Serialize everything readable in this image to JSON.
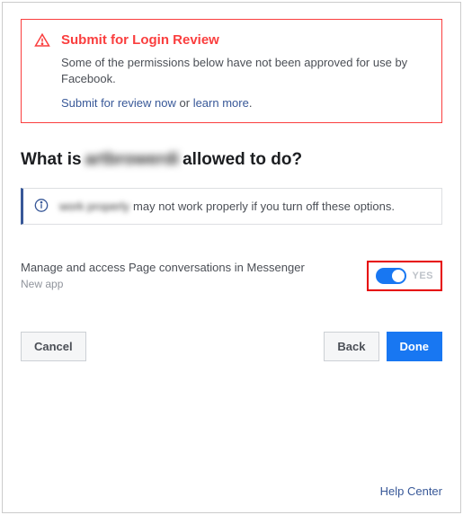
{
  "alert": {
    "title": "Submit for Login Review",
    "description": "Some of the permissions below have not been approved for use by Facebook.",
    "submit_link": "Submit for review now",
    "or_text": " or ",
    "learn_link": "learn more",
    "period": "."
  },
  "heading": {
    "prefix": "What is ",
    "blurred": "artbrowerdi",
    "suffix": "allowed to do?"
  },
  "info": {
    "blurred": "work properly",
    "text": "may not work properly if you turn off these options."
  },
  "permission": {
    "label": "Manage and access Page conversations in Messenger",
    "sublabel": "New app",
    "toggle_state": "YES"
  },
  "buttons": {
    "cancel": "Cancel",
    "back": "Back",
    "done": "Done"
  },
  "footer": {
    "help": "Help Center"
  }
}
